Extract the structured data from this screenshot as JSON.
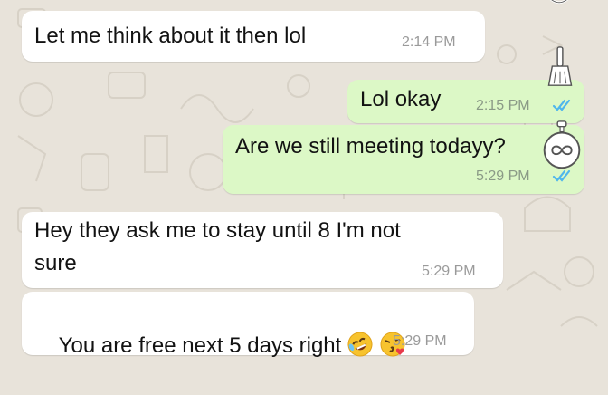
{
  "messages": [
    {
      "id": "m1",
      "direction": "incoming",
      "text": "Let me think about it then lol",
      "time": "2:14 PM"
    },
    {
      "id": "m2",
      "direction": "outgoing",
      "text": "Lol okay",
      "time": "2:15 PM",
      "status": "read"
    },
    {
      "id": "m3",
      "direction": "outgoing",
      "text": "Are we still meeting todayy?",
      "time": "5:29 PM",
      "status": "read"
    },
    {
      "id": "m4",
      "direction": "incoming",
      "text": "Hey they ask me to stay until 8 I'm not\nsure",
      "time": "5:29 PM"
    },
    {
      "id": "m5",
      "direction": "incoming",
      "text": "You are free next 5 days right",
      "time": "5:29 PM",
      "emojis": [
        "rolling-on-floor-laughing-emoji",
        "face-blowing-kiss-emoji"
      ]
    }
  ],
  "colors": {
    "incoming_bubble": "#ffffff",
    "outgoing_bubble": "#dcf8c6",
    "read_ticks": "#4fb6ec",
    "wallpaper": "#e8e3da"
  },
  "overlay_icons": [
    "broom-icon",
    "timer-icon",
    "ring-icon"
  ]
}
